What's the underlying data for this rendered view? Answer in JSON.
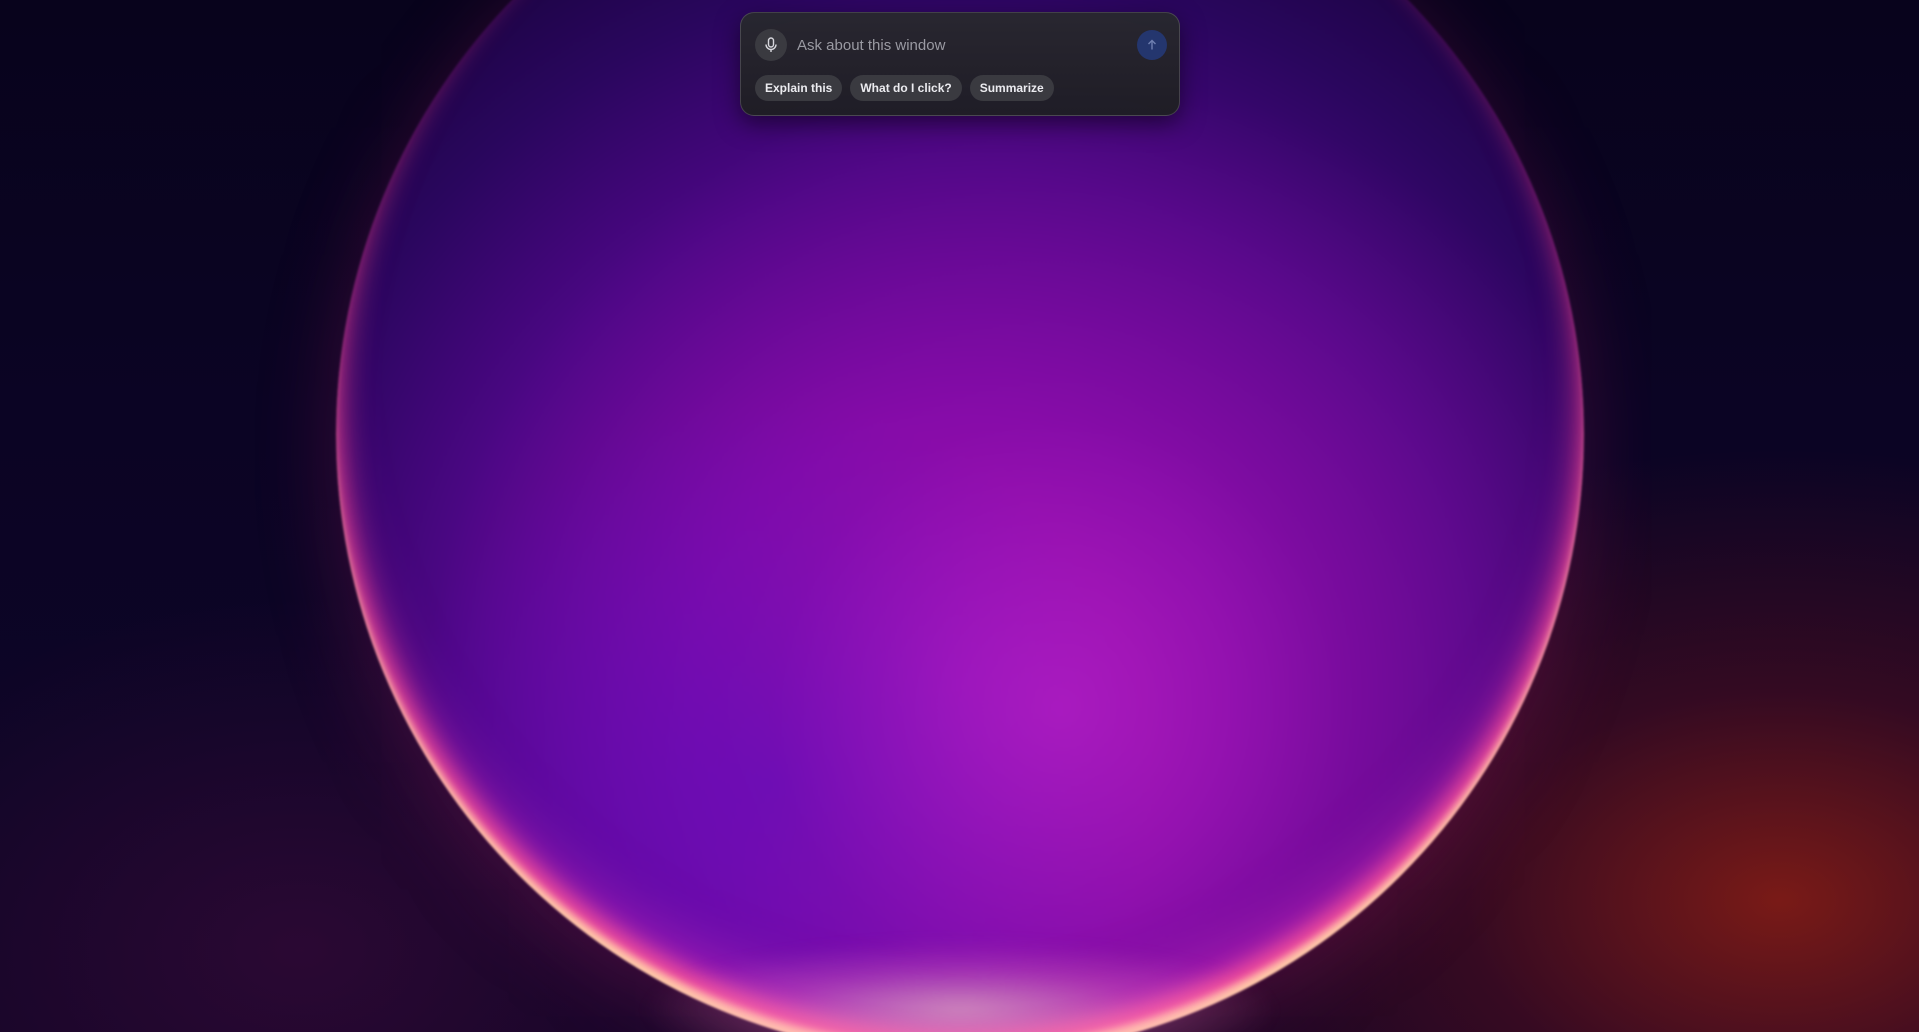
{
  "desktop": {
    "wallpaper": "abstract-purple-orb",
    "colors": {
      "background": "#08031c",
      "orb_core": "#9a0cb8",
      "orb_rim": "#ff5a96",
      "orb_highlight": "#ffd2aa",
      "ember": "#8c1e14"
    }
  },
  "assistant": {
    "mic_icon": "microphone-icon",
    "input_placeholder": "Ask about this window",
    "input_value": "",
    "send_icon": "arrow-up-icon",
    "send_button_color": "#24366e",
    "suggestions": [
      {
        "label": "Explain this"
      },
      {
        "label": "What do I click?"
      },
      {
        "label": "Summarize"
      }
    ]
  }
}
